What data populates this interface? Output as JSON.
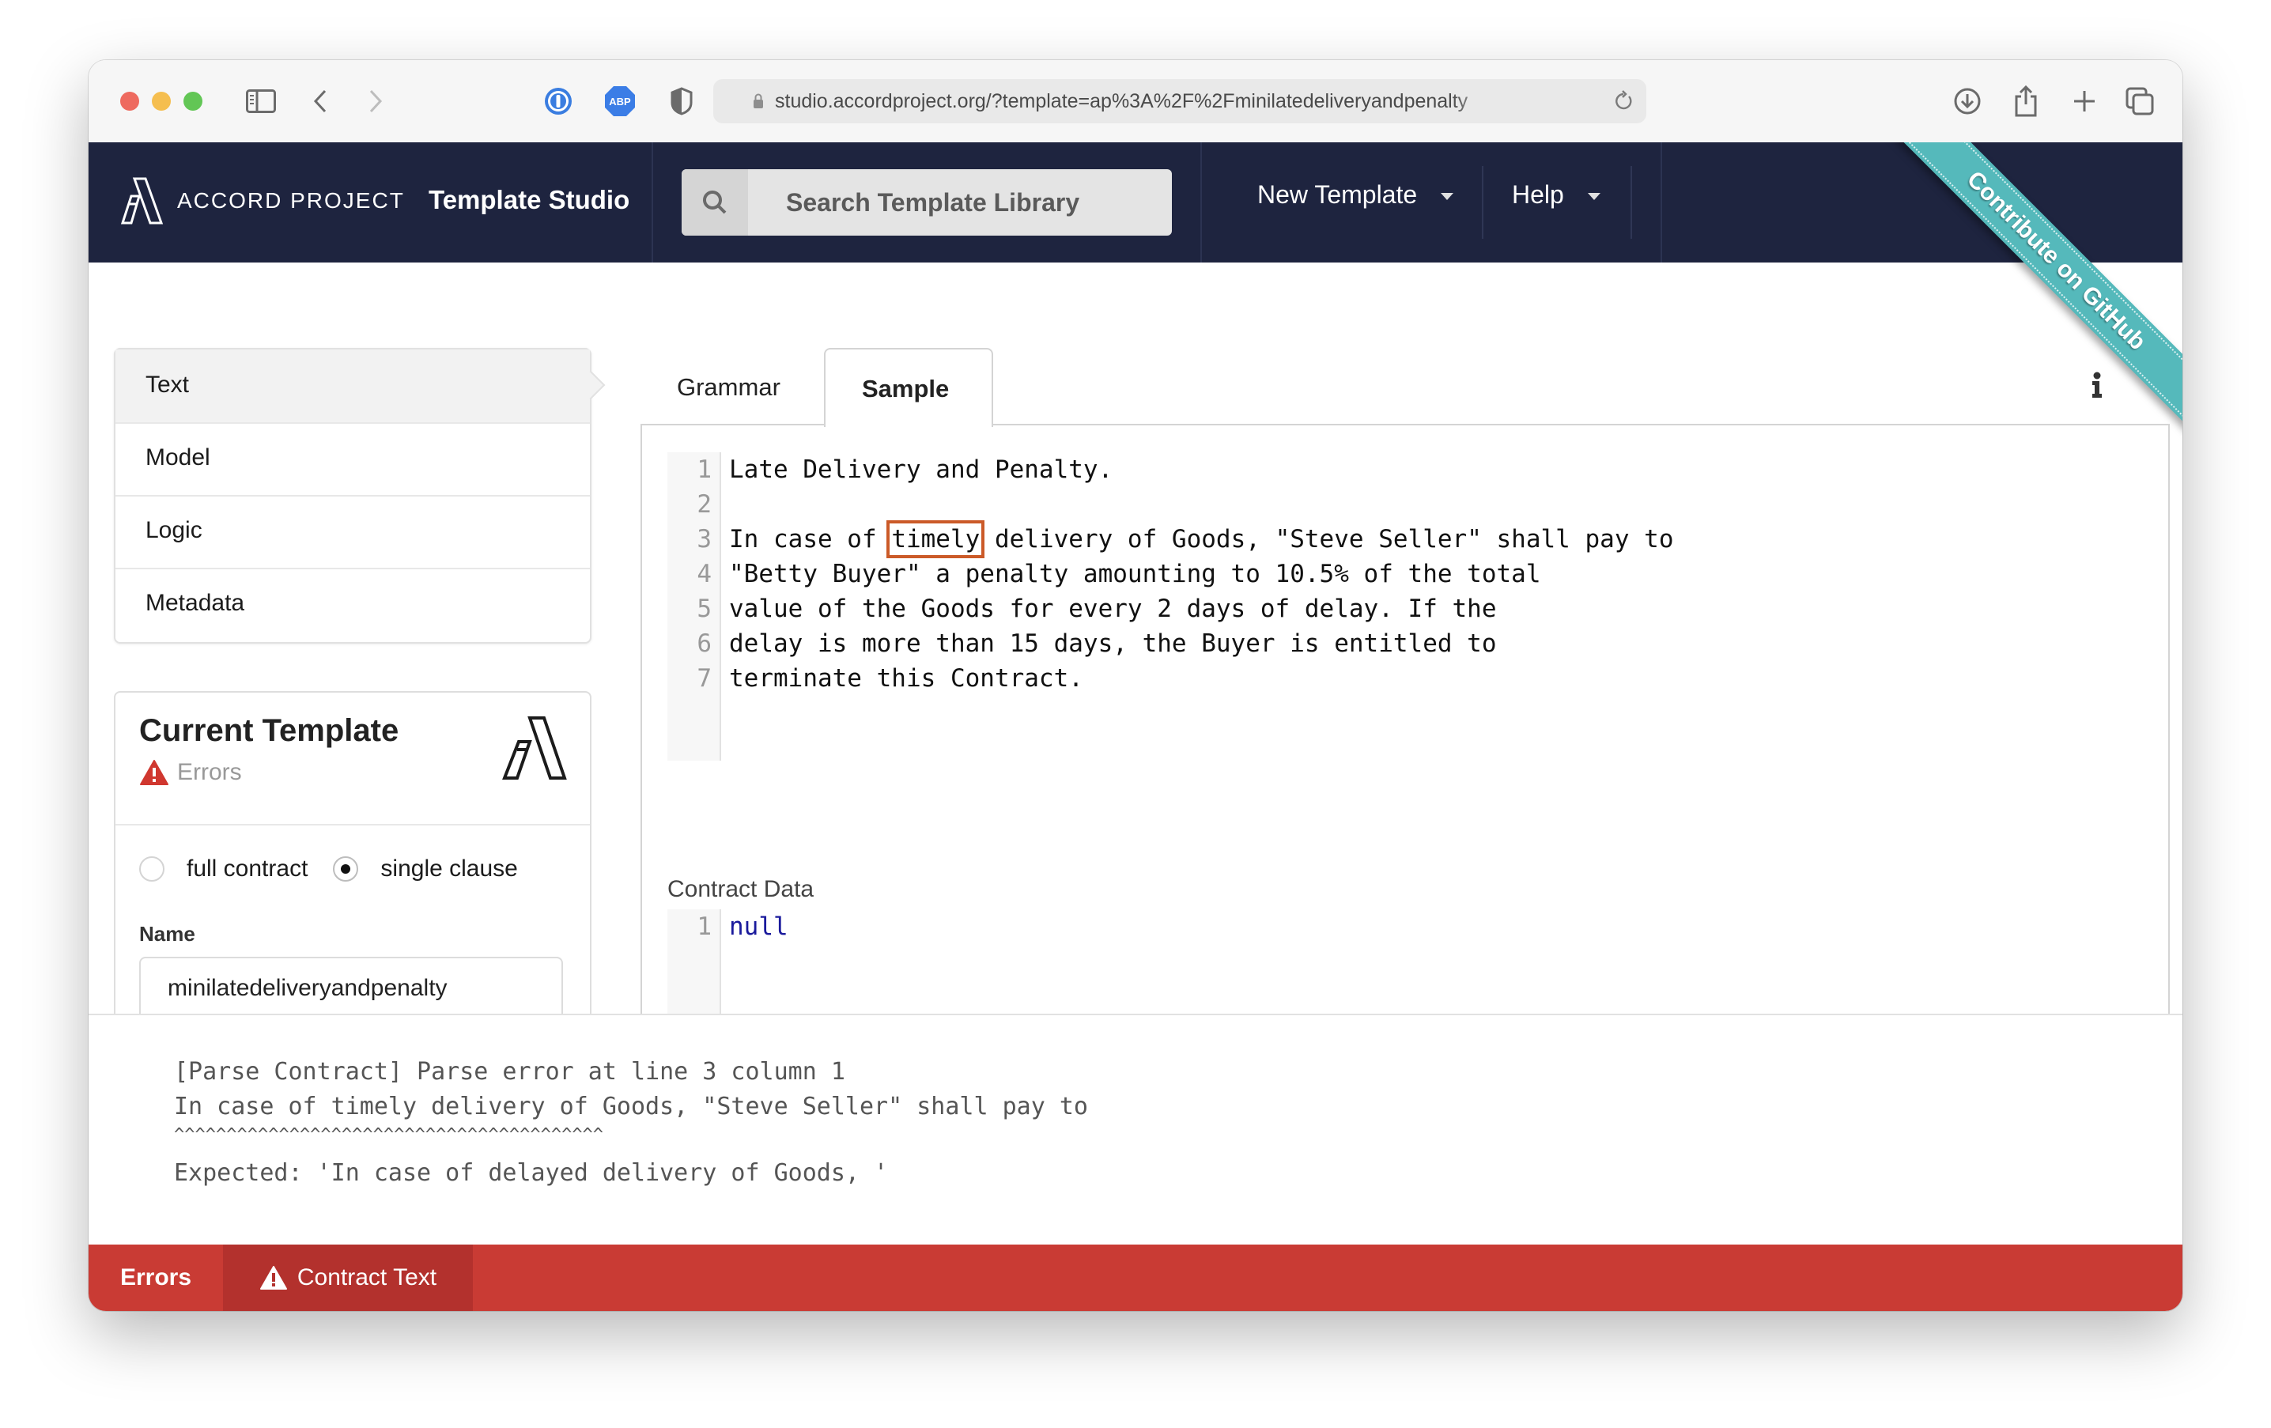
{
  "browser": {
    "url": "studio.accordproject.org/?template=ap%3A%2F%2Fminilatedeliveryandpenalty",
    "toolbar_icons": [
      "sidebar-icon",
      "back-icon",
      "forward-icon",
      "onepassword-icon",
      "adblock-icon",
      "privacy-shield-icon",
      "download-icon",
      "share-icon",
      "new-tab-icon",
      "tabs-overview-icon"
    ],
    "extension_abp_label": "ABP"
  },
  "header": {
    "brand": "ACCORD PROJECT",
    "app_name": "Template Studio",
    "search_placeholder": "Search Template Library",
    "menu": [
      {
        "label": "New Template"
      },
      {
        "label": "Help"
      }
    ],
    "ribbon": "Contribute on GitHub"
  },
  "sidebar": {
    "nav": [
      {
        "label": "Text",
        "active": true
      },
      {
        "label": "Model",
        "active": false
      },
      {
        "label": "Logic",
        "active": false
      },
      {
        "label": "Metadata",
        "active": false
      }
    ],
    "current_template": {
      "title": "Current Template",
      "status": "Errors",
      "mode_options": [
        {
          "label": "full contract",
          "checked": false
        },
        {
          "label": "single clause",
          "checked": true
        }
      ],
      "name_label": "Name",
      "name_value": "minilatedeliveryandpenalty"
    }
  },
  "editor": {
    "tabs": [
      {
        "label": "Grammar",
        "active": false
      },
      {
        "label": "Sample",
        "active": true
      }
    ],
    "sample_lines": [
      {
        "num": "1",
        "text": "Late Delivery and Penalty."
      },
      {
        "num": "2",
        "text": ""
      },
      {
        "num": "3",
        "pre": "In case of ",
        "error": "timely",
        "post": " delivery of Goods, \"Steve Seller\" shall pay to"
      },
      {
        "num": "4",
        "text": "\"Betty Buyer\" a penalty amounting to 10.5% of the total"
      },
      {
        "num": "5",
        "text": "value of the Goods for every 2 days of delay. If the"
      },
      {
        "num": "6",
        "text": "delay is more than 15 days, the Buyer is entitled to"
      },
      {
        "num": "7",
        "text": "terminate this Contract."
      }
    ],
    "contract_data_label": "Contract Data",
    "contract_data_lines": [
      {
        "num": "1",
        "text": "null"
      }
    ],
    "error_highlight_color": "#cb5a28"
  },
  "error_panel": {
    "lines": [
      "[Parse Contract] Parse error at line 3 column 1",
      "In case of timely delivery of Goods, \"Steve Seller\" shall pay to",
      "^^^^^^^^^^^^^^^^^^^^^^^^^^^^^^^^^^^^^^^^^",
      "Expected: 'In case of delayed delivery of Goods, '"
    ]
  },
  "footer": {
    "errors_label": "Errors",
    "tab_label": "Contract Text",
    "color": "#c93b34"
  }
}
